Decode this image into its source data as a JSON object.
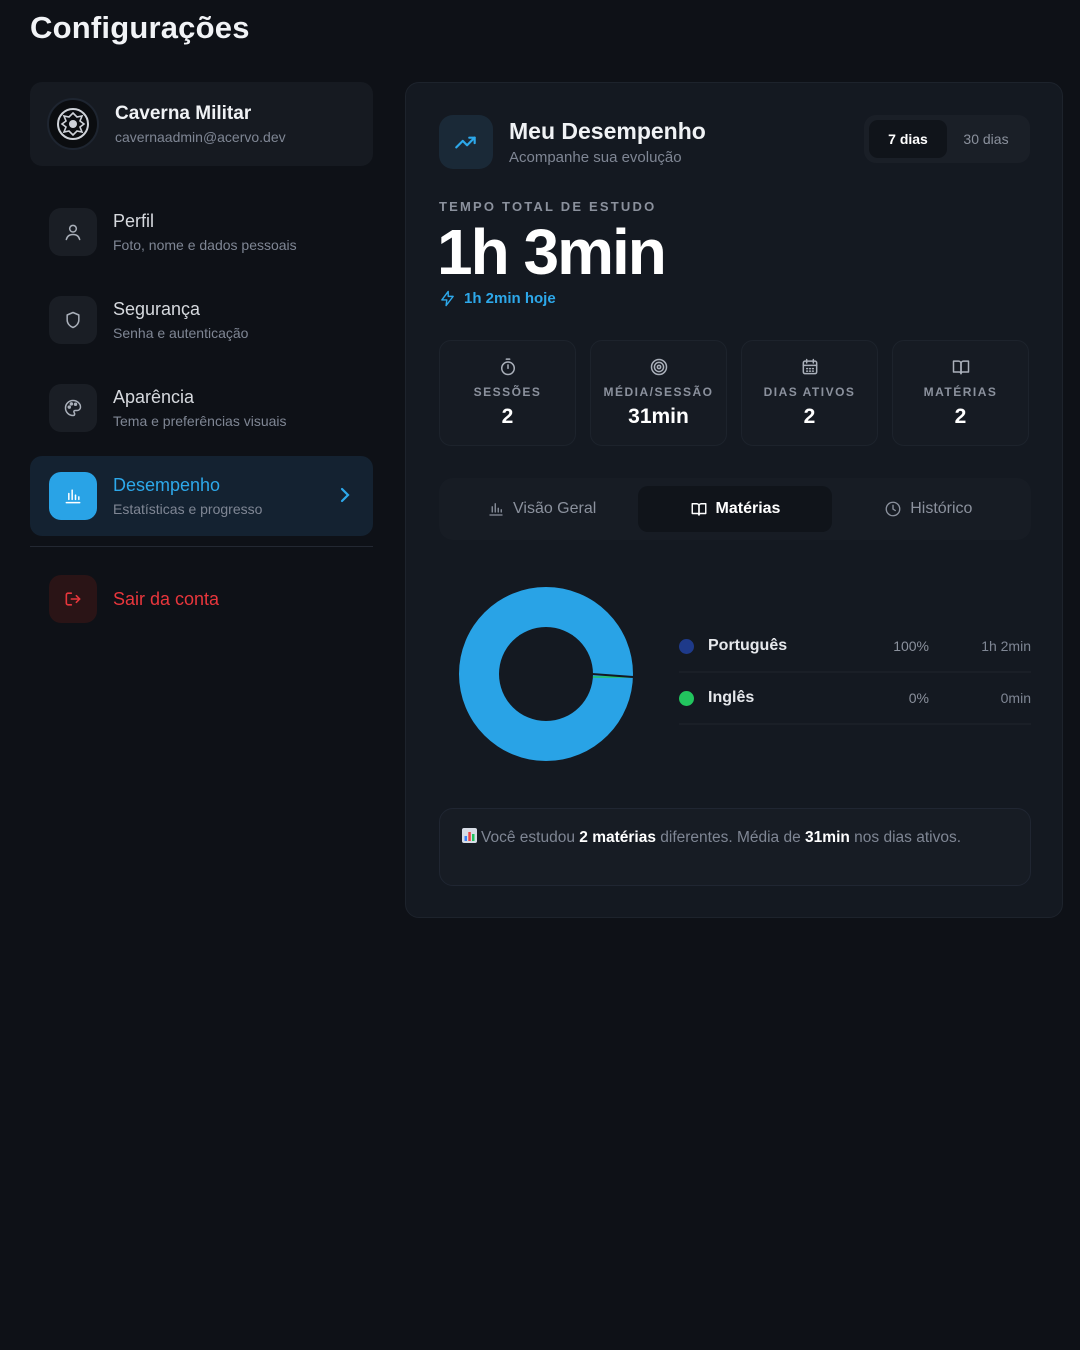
{
  "page_title": "Configurações",
  "user": {
    "name": "Caverna Militar",
    "email": "cavernaadmin@acervo.dev"
  },
  "nav": {
    "items": [
      {
        "label": "Perfil",
        "desc": "Foto, nome e dados pessoais",
        "icon": "user-icon"
      },
      {
        "label": "Segurança",
        "desc": "Senha e autenticação",
        "icon": "shield-icon"
      },
      {
        "label": "Aparência",
        "desc": "Tema e preferências visuais",
        "icon": "palette-icon"
      },
      {
        "label": "Desempenho",
        "desc": "Estatísticas e progresso",
        "icon": "bar-chart-icon",
        "active": true
      }
    ],
    "logout_label": "Sair da conta"
  },
  "panel": {
    "title": "Meu Desempenho",
    "subtitle": "Acompanhe sua evolução",
    "range_options": [
      "7 dias",
      "30 dias"
    ],
    "range_selected": "7 dias",
    "total_label": "TEMPO TOTAL DE ESTUDO",
    "total_value": "1h 3min",
    "today_text": "1h 2min hoje",
    "stats": [
      {
        "label": "SESSÕES",
        "value": "2",
        "icon": "stopwatch-icon"
      },
      {
        "label": "MÉDIA/SESSÃO",
        "value": "31min",
        "icon": "target-icon"
      },
      {
        "label": "DIAS ATIVOS",
        "value": "2",
        "icon": "calendar-icon"
      },
      {
        "label": "MATÉRIAS",
        "value": "2",
        "icon": "book-icon"
      }
    ],
    "tabs": [
      {
        "label": "Visão Geral",
        "icon": "bar-chart-icon"
      },
      {
        "label": "Matérias",
        "icon": "book-icon",
        "active": true
      },
      {
        "label": "Histórico",
        "icon": "clock-icon"
      }
    ],
    "summary": {
      "prefix": "Você estudou",
      "subjects": "2 matérias",
      "middle": "diferentes. Média de",
      "avg": "31min",
      "suffix": "nos dias ativos."
    }
  },
  "chart_data": {
    "type": "pie",
    "donut": true,
    "categories": [
      "Português",
      "Inglês"
    ],
    "values": [
      100,
      0
    ],
    "percent_labels": [
      "100%",
      "0%"
    ],
    "time_labels": [
      "1h 2min",
      "0min"
    ],
    "colors": [
      "#29a3e6",
      "#22c55e"
    ],
    "legend_dot_colors": [
      "#1e3a8a",
      "#22c55e"
    ]
  },
  "colors": {
    "accent": "#29a3e6",
    "danger": "#e8363c",
    "background": "#0e1117"
  }
}
